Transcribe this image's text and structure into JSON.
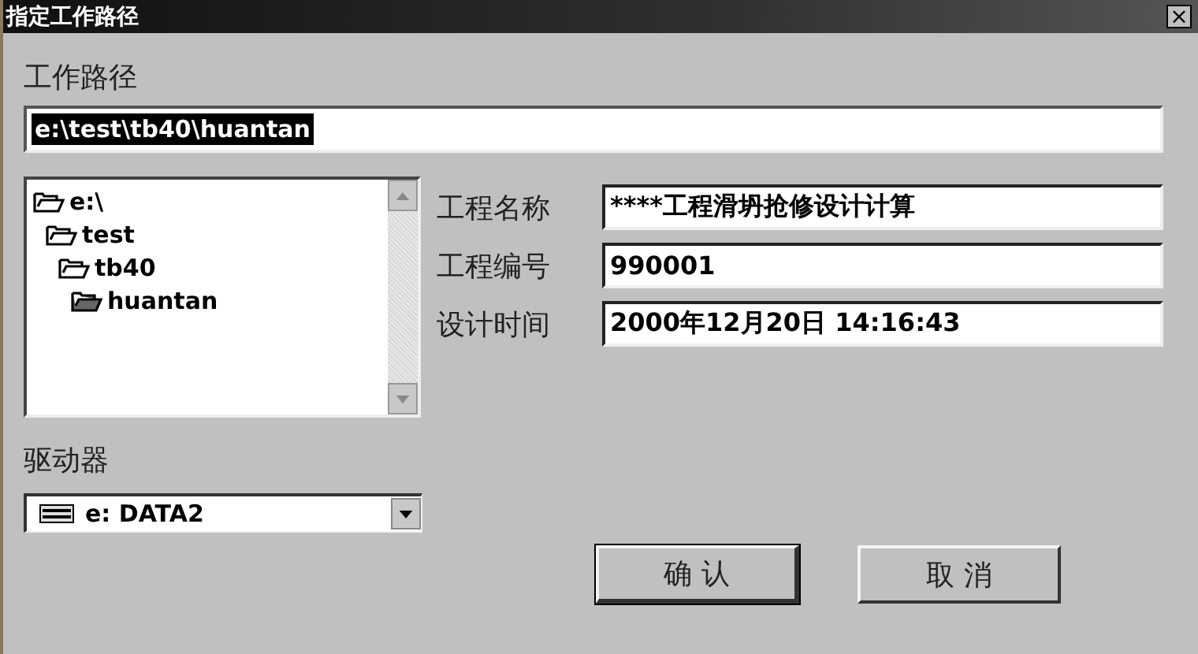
{
  "window": {
    "title": "指定工作路径",
    "close": "×"
  },
  "path": {
    "label": "工作路径",
    "value": "e:\\test\\tb40\\huantan",
    "text_selected": true
  },
  "directory_tree": [
    {
      "name": "e:\\",
      "selected": false,
      "children": [
        {
          "name": "test",
          "selected": false,
          "children": [
            {
              "name": "tb40",
              "selected": false,
              "children": [
                {
                  "name": "huantan",
                  "selected": true
                }
              ]
            }
          ]
        }
      ]
    }
  ],
  "fields": [
    {
      "label": "工程名称",
      "value": "****工程滑坍抢修设计计算"
    },
    {
      "label": "工程编号",
      "value": "990001"
    },
    {
      "label": "设计时间",
      "value": "2000年12月20日 14:16:43"
    }
  ],
  "drive": {
    "label": "驱动器",
    "value": "e: DATA2"
  },
  "buttons": [
    {
      "label": "确 认",
      "default": true
    },
    {
      "label": "取 消",
      "default": false
    }
  ]
}
